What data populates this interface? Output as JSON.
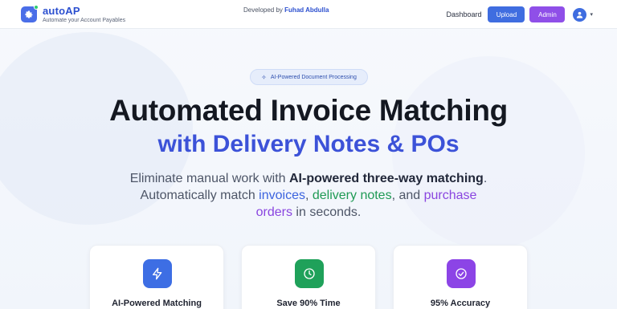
{
  "header": {
    "brand_name": "autoAP",
    "brand_tagline": "Automate your Account Payables",
    "credit_prefix": "Developed by ",
    "credit_author": "Fuhad Abdulla",
    "nav_dashboard": "Dashboard",
    "upload_label": "Upload",
    "admin_label": "Admin"
  },
  "hero": {
    "badge": "AI-Powered Document Processing",
    "title": "Automated Invoice Matching",
    "subtitle": "with Delivery Notes & POs",
    "desc_1": "Eliminate manual work with ",
    "desc_bold": "AI-powered three-way matching",
    "desc_2": ". Automatically match ",
    "desc_invoices": "invoices",
    "desc_3": ", ",
    "desc_delivery": "delivery notes",
    "desc_4": ", and ",
    "desc_purchase": "purchase orders",
    "desc_5": " in seconds."
  },
  "features": [
    {
      "title": "AI-Powered Matching",
      "icon": "lightning-icon",
      "color": "#3d6ee4"
    },
    {
      "title": "Save 90% Time",
      "icon": "clock-icon",
      "color": "#1fa15a"
    },
    {
      "title": "95% Accuracy",
      "icon": "check-circle-icon",
      "color": "#8c44e6"
    }
  ],
  "colors": {
    "primary": "#3f6de0",
    "accent_purple": "#8f4fe8",
    "accent_green": "#1f9a55"
  }
}
